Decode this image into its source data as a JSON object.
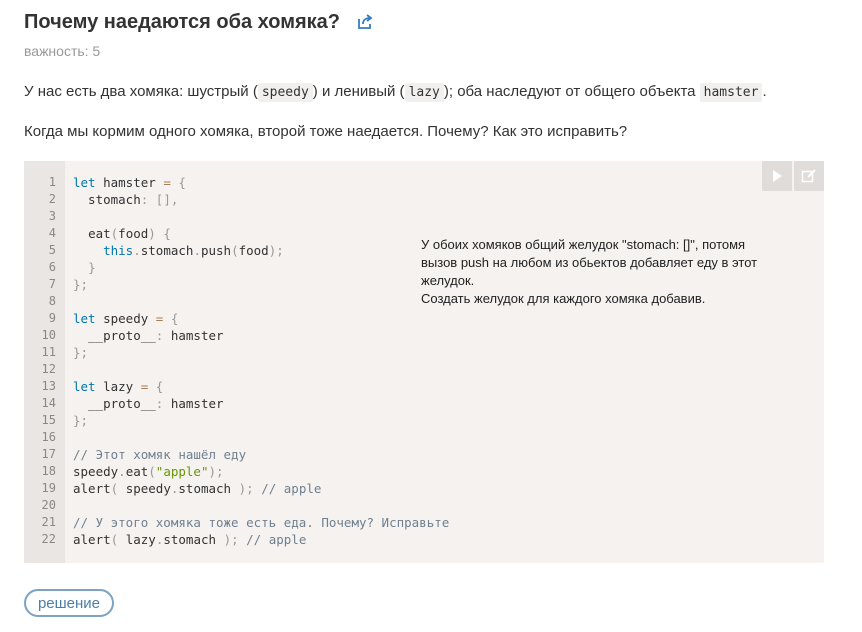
{
  "header": {
    "title": "Почему наедаются оба хомяка?"
  },
  "importance": "важность: 5",
  "para1": {
    "before": "У нас есть два хомяка: шустрый (",
    "code1": "speedy",
    "mid1": ") и ленивый (",
    "code2": "lazy",
    "mid2": "); оба наследуют от общего объекта",
    "code3": "hamster",
    "after": "."
  },
  "para2": "Когда мы кормим одного хомяка, второй тоже наедается. Почему? Как это исправить?",
  "code_lines": [
    "1",
    "2",
    "3",
    "4",
    "5",
    "6",
    "7",
    "8",
    "9",
    "10",
    "11",
    "12",
    "13",
    "14",
    "15",
    "16",
    "17",
    "18",
    "19",
    "20",
    "21",
    "22"
  ],
  "note": {
    "line1": "У обоих хомяков общий желудок \"stomach: []\", потомя",
    "line2": "вызов push на любом из обьектов добавляет еду в этот",
    "line3": "желудок.",
    "line4": "Создать желудок для каждого хомяка добавив."
  },
  "toolbar": {
    "run_icon": "play-icon",
    "edit_icon": "edit-icon"
  },
  "solution_button": "решение"
}
